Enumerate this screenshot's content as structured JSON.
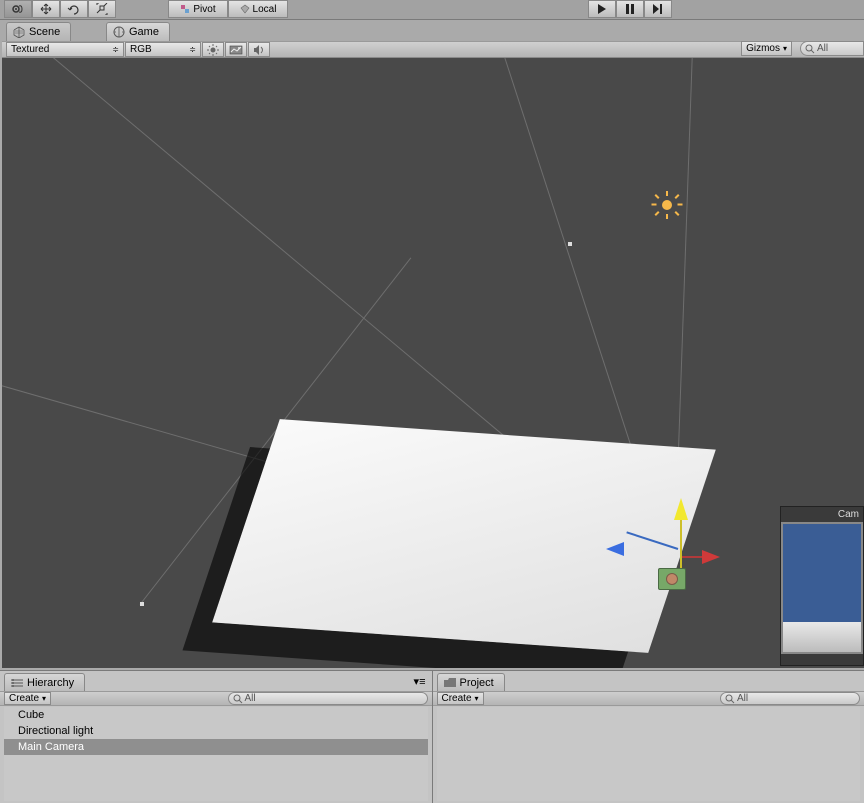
{
  "toolbar": {
    "transform_tools": [
      "hand",
      "move",
      "rotate",
      "scale"
    ],
    "pivot_label": "Pivot",
    "local_label": "Local"
  },
  "playback": {
    "play": "play",
    "pause": "pause",
    "step": "step"
  },
  "tabs": {
    "scene": "Scene",
    "game": "Game"
  },
  "scene_sub": {
    "draw_mode": "Textured",
    "render_mode": "RGB",
    "lighting_icon": "light-icon",
    "fx_icon": "fx-icon",
    "audio_icon": "audio-icon",
    "gizmos_label": "Gizmos",
    "search_placeholder": "All"
  },
  "camera_preview": {
    "title": "Cam"
  },
  "hierarchy": {
    "tab_label": "Hierarchy",
    "create_label": "Create",
    "search_placeholder": "All",
    "items": [
      {
        "label": "Cube",
        "selected": false
      },
      {
        "label": "Directional light",
        "selected": false
      },
      {
        "label": "Main Camera",
        "selected": true
      }
    ]
  },
  "project": {
    "tab_label": "Project",
    "create_label": "Create",
    "search_placeholder": "All"
  }
}
